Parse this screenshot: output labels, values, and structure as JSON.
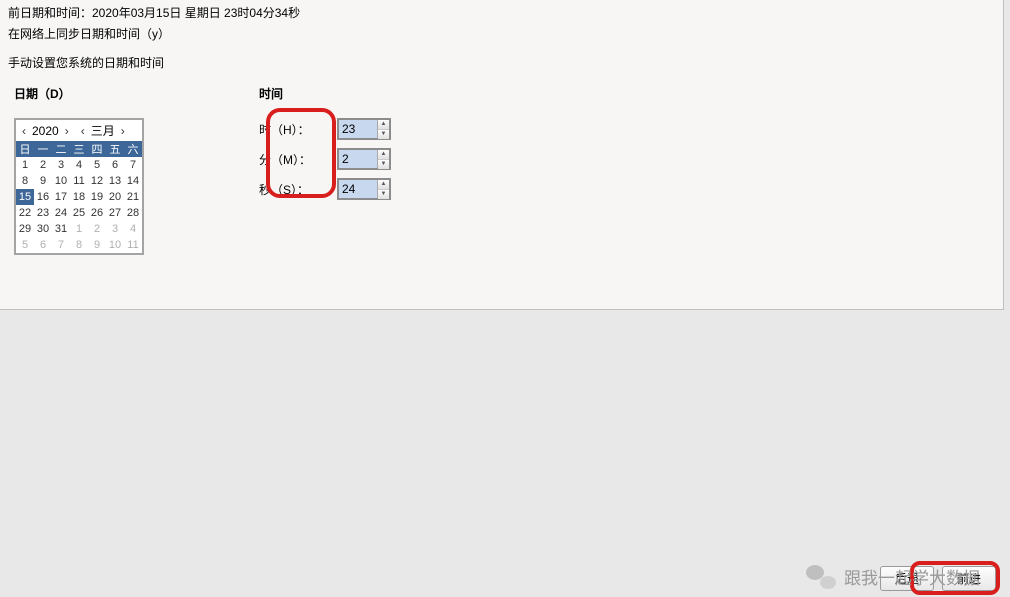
{
  "header": {
    "current_line": "前日期和时间：2020年03月15日 星期日 23时04分34秒",
    "sync_line": "在网络上同步日期和时间（y）",
    "manual_line": "手动设置您系统的日期和时间"
  },
  "date": {
    "label": "日期（D）",
    "year": "2020",
    "month": "三月",
    "weekdays": [
      "日",
      "一",
      "二",
      "三",
      "四",
      "五",
      "六"
    ],
    "rows": [
      [
        {
          "v": "1"
        },
        {
          "v": "2"
        },
        {
          "v": "3"
        },
        {
          "v": "4"
        },
        {
          "v": "5"
        },
        {
          "v": "6"
        },
        {
          "v": "7"
        }
      ],
      [
        {
          "v": "8"
        },
        {
          "v": "9"
        },
        {
          "v": "10"
        },
        {
          "v": "11"
        },
        {
          "v": "12"
        },
        {
          "v": "13"
        },
        {
          "v": "14"
        }
      ],
      [
        {
          "v": "15",
          "sel": true
        },
        {
          "v": "16"
        },
        {
          "v": "17"
        },
        {
          "v": "18"
        },
        {
          "v": "19"
        },
        {
          "v": "20"
        },
        {
          "v": "21"
        }
      ],
      [
        {
          "v": "22"
        },
        {
          "v": "23"
        },
        {
          "v": "24"
        },
        {
          "v": "25"
        },
        {
          "v": "26"
        },
        {
          "v": "27"
        },
        {
          "v": "28"
        }
      ],
      [
        {
          "v": "29"
        },
        {
          "v": "30"
        },
        {
          "v": "31"
        },
        {
          "v": "1",
          "dim": true
        },
        {
          "v": "2",
          "dim": true
        },
        {
          "v": "3",
          "dim": true
        },
        {
          "v": "4",
          "dim": true
        }
      ],
      [
        {
          "v": "5",
          "dim": true
        },
        {
          "v": "6",
          "dim": true
        },
        {
          "v": "7",
          "dim": true
        },
        {
          "v": "8",
          "dim": true
        },
        {
          "v": "9",
          "dim": true
        },
        {
          "v": "10",
          "dim": true
        },
        {
          "v": "11",
          "dim": true
        }
      ]
    ]
  },
  "time": {
    "label": "时间",
    "hour_label": "时（H）：",
    "minute_label": "分（M）：",
    "second_label": "秒（S）：",
    "hour": "23",
    "minute": "2",
    "second": "24"
  },
  "buttons": {
    "back": "后退",
    "next": "前进"
  },
  "nav_glyphs": {
    "prev": "‹",
    "next": "›",
    "up": "▲",
    "down": "▼"
  },
  "watermark": "跟我一起学大数据"
}
